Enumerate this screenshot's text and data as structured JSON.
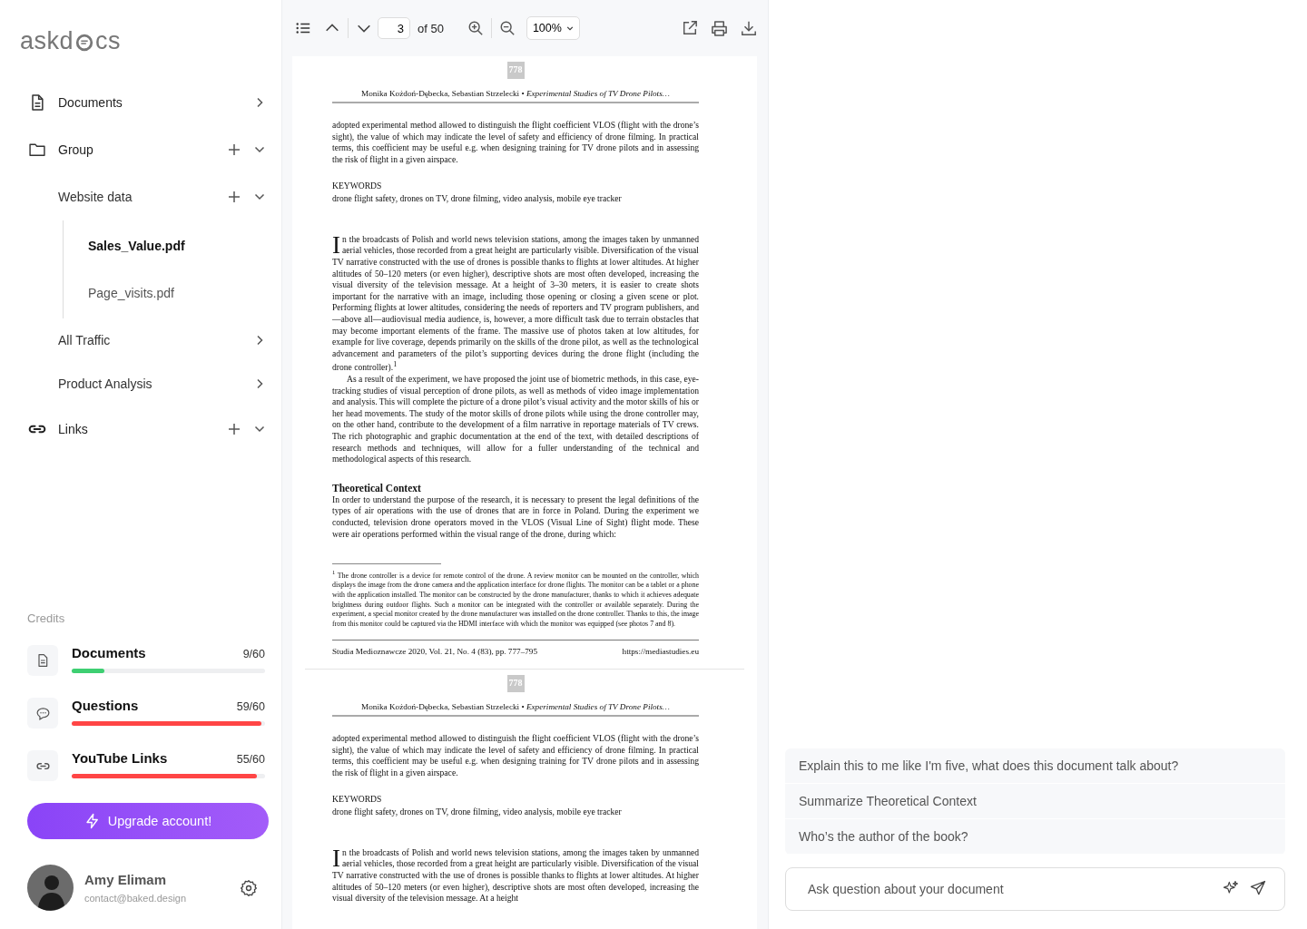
{
  "logo": {
    "before": "askd",
    "after": "cs"
  },
  "nav": [
    {
      "label": "Documents",
      "kind": "link"
    },
    {
      "label": "Group",
      "kind": "group",
      "children": [
        {
          "label": "Website data",
          "kind": "group",
          "children": [
            {
              "label": "Sales_Value.pdf",
              "selected": true
            },
            {
              "label": "Page_visits.pdf",
              "selected": false
            }
          ]
        },
        {
          "label": "All Traffic",
          "kind": "link"
        },
        {
          "label": "Product Analysis",
          "kind": "link"
        }
      ]
    },
    {
      "label": "Links",
      "kind": "group"
    }
  ],
  "credits": {
    "title": "Credits",
    "items": [
      {
        "label": "Documents",
        "count": "9/60",
        "level": 0.17,
        "color": "#3ecf72"
      },
      {
        "label": "Questions",
        "count": "59/60",
        "level": 0.98,
        "color": "#ff4545"
      },
      {
        "label": "YouTube Links",
        "count": "55/60",
        "level": 0.96,
        "color": "#ff4545"
      }
    ]
  },
  "upgrade_button": "Upgrade account!",
  "user": {
    "name": "Amy Elimam",
    "email": "contact@baked.design"
  },
  "toolbar": {
    "page": "3",
    "of": "of 50",
    "zoom": "100%"
  },
  "pages": [
    {
      "number": "778",
      "header": "Monika Kożdoń-Dębecka, Sebastian Strzelecki • *Experimental Studies of TV Drone Pilots…*",
      "blocks": [
        {
          "kind": "paragraph",
          "text": "adopted experimental method allowed to distinguish the flight coefficient VLOS (flight with the drone’s sight), the value of which may indicate the level of safety and efficiency of drone filming. In practical terms, this coefficient may be useful e.g. when designing training for TV drone pilots and in assessing the risk of flight in a given airspace."
        },
        {
          "kind": "label",
          "text": "KEYWORDS"
        },
        {
          "kind": "plain",
          "text": "drone flight safety, drones on TV, drone filming, video analysis, mobile eye tracker"
        },
        {
          "kind": "dropcap",
          "text": "In the broadcasts of Polish and world news television stations, among the images taken by unmanned aerial vehicles, those recorded from a great height are particularly visible. Diversification of the visual TV narrative constructed with the use of drones is possible thanks to flights at lower altitudes. At higher altitudes of 50–120 meters (or even higher), descriptive shots are most often developed, increasing the visual diversity of the television message. At a height of 3–30 meters, it is easier to create shots important for the narrative with an image, including those opening or closing a given scene or plot. Performing flights at lower altitudes, considering the needs of reporters and TV program publishers, and—above all—audiovisual media audience, is, however, a more difficult task due to terrain obstacles that may become important elements of the frame. The massive use of photos taken at low altitudes, for example for live coverage, depends primarily on the skills of the drone pilot, as well as the technological advancement and parameters of the pilot’s supporting devices during the drone flight (including the drone controller).$^{1}$"
        },
        {
          "kind": "indented",
          "text": "As a result of the experiment, we have proposed the joint use of biometric methods, in this case, eye-tracking studies of visual perception of drone pilots, as well as methods of video image implementation and analysis. This will complete the picture of a drone pilot’s visual activity and the motor skills of his or her head movements. The study of the motor skills of drone pilots while using the drone controller may, on the other hand, contribute to the development of a film narrative in reportage materials of TV crews. The rich photographic and graphic documentation at the end of the text, with detailed descriptions of research methods and techniques, will allow for a fuller understanding of the technical and methodological aspects of this research."
        },
        {
          "kind": "heading",
          "text": "Theoretical Context"
        },
        {
          "kind": "paragraph",
          "text": "In order to understand the purpose of the research, it is necessary to present the legal definitions of the types of air operations with the use of drones that are in force in Poland. During the experiment we conducted, television drone operators moved in the VLOS (Visual Line of Sight) flight mode. These were air operations performed within the visual range of the drone, during which:"
        },
        {
          "kind": "footnote",
          "text": "$^{1}$ The drone controller is a device for remote control of the drone. A review monitor can be mounted on the controller, which displays the image from the drone camera and the application interface for drone flights. The monitor can be a tablet or a phone with the application installed. The monitor can be constructed by the drone manufacturer, thanks to which it achieves adequate brightness during outdoor flights. Such a monitor can be integrated with the controller or available separately. During the experiment, a special monitor created by the drone manufacturer was installed on the drone controller. Thanks to this, the image from this monitor could be captured via the HDMI interface with which the monitor was equipped (see photos 7 and 8)."
        }
      ],
      "footer": {
        "left": "Studia Medioznawcze 2020, Vol. 21, No. 4 (83), pp. 777–795",
        "right": "https://mediastudies.eu"
      }
    },
    {
      "number": "778",
      "header": "Monika Kożdoń-Dębecka, Sebastian Strzelecki • *Experimental Studies of TV Drone Pilots…*",
      "blocks": [
        {
          "kind": "paragraph",
          "text": "adopted experimental method allowed to distinguish the flight coefficient VLOS (flight with the drone’s sight), the value of which may indicate the level of safety and efficiency of drone filming. In practical terms, this coefficient may be useful e.g. when designing training for TV drone pilots and in assessing the risk of flight in a given airspace."
        },
        {
          "kind": "label",
          "text": "KEYWORDS"
        },
        {
          "kind": "plain",
          "text": "drone flight safety, drones on TV, drone filming, video analysis, mobile eye tracker"
        },
        {
          "kind": "dropcap",
          "text": "In the broadcasts of Polish and world news television stations, among the images taken by unmanned aerial vehicles, those recorded from a great height are particularly visible. Diversification of the visual TV narrative constructed with the use of drones is possible thanks to flights at lower altitudes. At higher altitudes of 50–120 meters (or even higher), descriptive shots are most often developed, increasing the visual diversity of the television message. At a height"
        }
      ]
    }
  ],
  "suggestions": [
    "Explain this to me like I'm five, what does this document talk about?",
    "Summarize Theoretical Context",
    "Who’s the author of the book?"
  ],
  "ask": {
    "placeholder": "Ask question about your document"
  }
}
